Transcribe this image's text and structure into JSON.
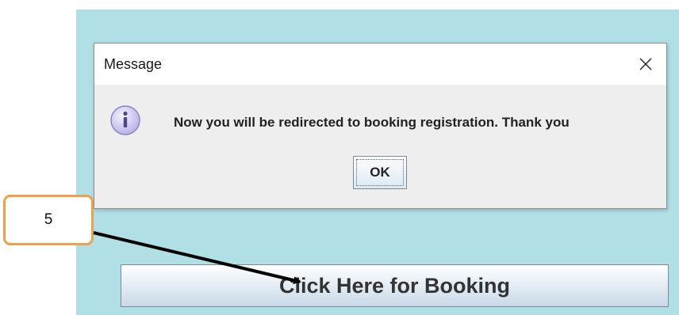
{
  "dialog": {
    "title": "Message",
    "message": "Now you will be redirected to booking registration. Thank you",
    "ok_label": "OK",
    "icon": "info-icon",
    "close_icon": "close-icon"
  },
  "main": {
    "booking_button_label": "Click Here for Booking"
  },
  "annotation": {
    "step_number": "5"
  },
  "colors": {
    "app_background": "#b0dfe5",
    "dialog_background": "#eeeeee",
    "callout_border": "#f0a04b",
    "arrow": "#000000"
  }
}
